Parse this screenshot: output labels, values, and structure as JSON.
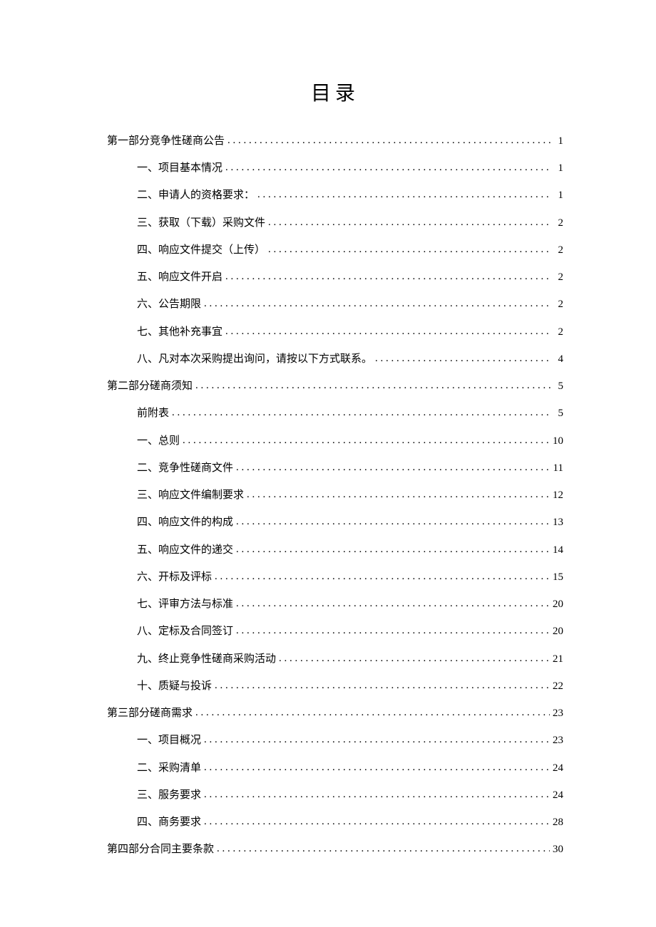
{
  "title": "目录",
  "toc": [
    {
      "level": 1,
      "text": "第一部分竞争性磋商公告",
      "page": "1"
    },
    {
      "level": 2,
      "text": "一、项目基本情况",
      "page": "1"
    },
    {
      "level": 2,
      "text": "二、申请人的资格要求：",
      "page": "1"
    },
    {
      "level": 2,
      "text": "三、获取（下载）采购文件",
      "page": "2"
    },
    {
      "level": 2,
      "text": "四、响应文件提交（上传）",
      "page": "2"
    },
    {
      "level": 2,
      "text": "五、响应文件开启",
      "page": "2"
    },
    {
      "level": 2,
      "text": "六、公告期限",
      "page": "2"
    },
    {
      "level": 2,
      "text": "七、其他补充事宜",
      "page": "2"
    },
    {
      "level": 2,
      "text": "八、凡对本次采购提出询问，请按以下方式联系。",
      "page": "4"
    },
    {
      "level": 1,
      "text": "第二部分磋商须知",
      "page": "5"
    },
    {
      "level": 2,
      "text": "前附表",
      "page": "5"
    },
    {
      "level": 2,
      "text": "一、总则",
      "page": "10"
    },
    {
      "level": 2,
      "text": "二、竞争性磋商文件",
      "page": "11"
    },
    {
      "level": 2,
      "text": "三、响应文件编制要求",
      "page": "12"
    },
    {
      "level": 2,
      "text": "四、响应文件的构成",
      "page": "13"
    },
    {
      "level": 2,
      "text": "五、响应文件的递交",
      "page": "14"
    },
    {
      "level": 2,
      "text": "六、开标及评标",
      "page": "15"
    },
    {
      "level": 2,
      "text": "七、评审方法与标准",
      "page": "20"
    },
    {
      "level": 2,
      "text": "八、定标及合同签订",
      "page": "20"
    },
    {
      "level": 2,
      "text": "九、终止竞争性磋商采购活动",
      "page": "21"
    },
    {
      "level": 2,
      "text": "十、质疑与投诉",
      "page": "22"
    },
    {
      "level": 1,
      "text": "第三部分磋商需求",
      "page": "23"
    },
    {
      "level": 2,
      "text": "一、项目概况",
      "page": "23"
    },
    {
      "level": 2,
      "text": "二、采购清单",
      "page": "24"
    },
    {
      "level": 2,
      "text": "三、服务要求",
      "page": "24"
    },
    {
      "level": 2,
      "text": "四、商务要求",
      "page": "28"
    },
    {
      "level": 1,
      "text": "第四部分合同主要条款",
      "page": "30"
    }
  ]
}
